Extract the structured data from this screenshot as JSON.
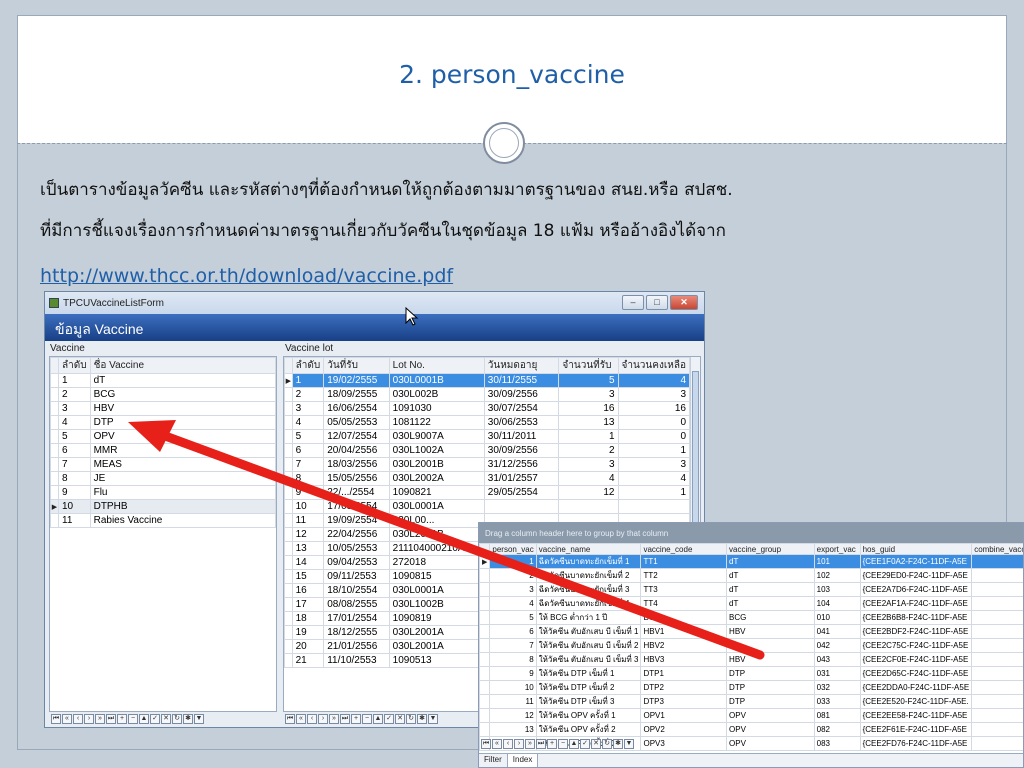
{
  "slide": {
    "title": "2. person_vaccine",
    "body_line1": "เป็นตารางข้อมูลวัคซีน และรหัสต่างๆที่ต้องกำหนดให้ถูกต้องตามมาตรฐานของ สนย.หรือ สปสช.",
    "body_line2": "ที่มีการชี้แจงเรื่องการกำหนดค่ามาตรฐานเกี่ยวกับวัคซีนในชุดข้อมูล 18 แฟ้ม หรืออ้างอิงได้จาก",
    "link": "http://www.thcc.or.th/download/vaccine.pdf"
  },
  "form": {
    "window_title": "TPCUVaccineListForm",
    "header": "ข้อมูล Vaccine",
    "left_panel_label": "Vaccine",
    "right_panel_label": "Vaccine lot",
    "left_columns": [
      "ลำดับ",
      "ชื่อ Vaccine"
    ],
    "vaccines": [
      {
        "no": "1",
        "name": "dT"
      },
      {
        "no": "2",
        "name": "BCG"
      },
      {
        "no": "3",
        "name": "HBV"
      },
      {
        "no": "4",
        "name": "DTP"
      },
      {
        "no": "5",
        "name": "OPV"
      },
      {
        "no": "6",
        "name": "MMR"
      },
      {
        "no": "7",
        "name": "MEAS"
      },
      {
        "no": "8",
        "name": "JE"
      },
      {
        "no": "9",
        "name": "Flu"
      },
      {
        "no": "10",
        "name": "DTPHB"
      },
      {
        "no": "11",
        "name": "Rabies Vaccine"
      }
    ],
    "selected_vaccine_index": 9,
    "lot_columns": [
      "ลำดับ",
      "วันที่รับ",
      "Lot No.",
      "วันหมดอายุ",
      "จำนวนที่รับ",
      "จำนวนคงเหลือ"
    ],
    "lots": [
      {
        "no": "1",
        "received": "19/02/2555",
        "lot": "030L0001B",
        "expiry": "30/11/2555",
        "qty": "5",
        "remain": "4"
      },
      {
        "no": "2",
        "received": "18/09/2555",
        "lot": "030L002B",
        "expiry": "30/09/2556",
        "qty": "3",
        "remain": "3"
      },
      {
        "no": "3",
        "received": "16/06/2554",
        "lot": "1091030",
        "expiry": "30/07/2554",
        "qty": "16",
        "remain": "16"
      },
      {
        "no": "4",
        "received": "05/05/2553",
        "lot": "1081122",
        "expiry": "30/06/2553",
        "qty": "13",
        "remain": "0"
      },
      {
        "no": "5",
        "received": "12/07/2554",
        "lot": "030L9007A",
        "expiry": "30/11/2011",
        "qty": "1",
        "remain": "0"
      },
      {
        "no": "6",
        "received": "20/04/2556",
        "lot": "030L1002A",
        "expiry": "30/09/2556",
        "qty": "2",
        "remain": "1"
      },
      {
        "no": "7",
        "received": "18/03/2556",
        "lot": "030L2001B",
        "expiry": "31/12/2556",
        "qty": "3",
        "remain": "3"
      },
      {
        "no": "8",
        "received": "15/05/2556",
        "lot": "030L2002A",
        "expiry": "31/01/2557",
        "qty": "4",
        "remain": "4"
      },
      {
        "no": "9",
        "received": "22/.../2554",
        "lot": "1090821",
        "expiry": "29/05/2554",
        "qty": "12",
        "remain": "1"
      },
      {
        "no": "10",
        "received": "17/08/2554",
        "lot": "030L0001A",
        "expiry": "",
        "qty": "",
        "remain": ""
      },
      {
        "no": "11",
        "received": "19/09/2554",
        "lot": "030L00...",
        "expiry": "",
        "qty": "",
        "remain": ""
      },
      {
        "no": "12",
        "received": "22/04/2556",
        "lot": "030L2001B",
        "expiry": "",
        "qty": "",
        "remain": ""
      },
      {
        "no": "13",
        "received": "10/05/2553",
        "lot": "211104000210A",
        "expiry": "",
        "qty": "",
        "remain": ""
      },
      {
        "no": "14",
        "received": "09/04/2553",
        "lot": "272018",
        "expiry": "",
        "qty": "",
        "remain": ""
      },
      {
        "no": "15",
        "received": "09/11/2553",
        "lot": "1090815",
        "expiry": "",
        "qty": "",
        "remain": ""
      },
      {
        "no": "16",
        "received": "18/10/2554",
        "lot": "030L0001A",
        "expiry": "",
        "qty": "",
        "remain": ""
      },
      {
        "no": "17",
        "received": "08/08/2555",
        "lot": "030L1002B",
        "expiry": "",
        "qty": "",
        "remain": ""
      },
      {
        "no": "18",
        "received": "17/01/2554",
        "lot": "1090819",
        "expiry": "",
        "qty": "",
        "remain": ""
      },
      {
        "no": "19",
        "received": "18/12/2555",
        "lot": "030L2001A",
        "expiry": "",
        "qty": "",
        "remain": ""
      },
      {
        "no": "20",
        "received": "21/01/2556",
        "lot": "030L2001A",
        "expiry": "",
        "qty": "",
        "remain": ""
      },
      {
        "no": "21",
        "received": "11/10/2553",
        "lot": "1090513",
        "expiry": "",
        "qty": "",
        "remain": ""
      }
    ],
    "selected_lot_index": 0
  },
  "grid2": {
    "group_hint": "Drag a column header here to group by that column",
    "columns": [
      "person_vac",
      "vaccine_name",
      "vaccine_code",
      "vaccine_group",
      "export_vac",
      "hos_guid",
      "combine_vaccine"
    ],
    "rows": [
      {
        "id": "1",
        "name": "ฉีดวัคซีนบาดทะยักเข็มที่ 1",
        "code": "TT1",
        "group": "dT",
        "export": "101",
        "guid": "{CEE1F0A2-F24C-11DF-A5E"
      },
      {
        "id": "2",
        "name": "ฉีดวัคซีนบาดทะยักเข็มที่ 2",
        "code": "TT2",
        "group": "dT",
        "export": "102",
        "guid": "{CEE29ED0-F24C-11DF-A5E"
      },
      {
        "id": "3",
        "name": "ฉีดวัคซีนบาดทะยักเข็มที่ 3",
        "code": "TT3",
        "group": "dT",
        "export": "103",
        "guid": "{CEE2A7D6-F24C-11DF-A5E"
      },
      {
        "id": "4",
        "name": "ฉีดวัคซีนบาดทะยักเข็มที่ 4",
        "code": "TT4",
        "group": "dT",
        "export": "104",
        "guid": "{CEE2AF1A-F24C-11DF-A5E"
      },
      {
        "id": "5",
        "name": "ให้ BCG ต่ำกว่า 1 ปี",
        "code": "BCG",
        "group": "BCG",
        "export": "010",
        "guid": "{CEE2B6B8-F24C-11DF-A5E"
      },
      {
        "id": "6",
        "name": "ให้วัคซีน ตับอักเสบ บี เข็มที่ 1",
        "code": "HBV1",
        "group": "HBV",
        "export": "041",
        "guid": "{CEE2BDF2-F24C-11DF-A5E"
      },
      {
        "id": "7",
        "name": "ให้วัคซีน ตับอักเสบ บี เข็มที่ 2",
        "code": "HBV2",
        "group": "",
        "export": "042",
        "guid": "{CEE2C75C-F24C-11DF-A5E"
      },
      {
        "id": "8",
        "name": "ให้วัคซีน ตับอักเสบ บี เข็มที่ 3",
        "code": "HBV3",
        "group": "HBV",
        "export": "043",
        "guid": "{CEE2CF0E-F24C-11DF-A5E"
      },
      {
        "id": "9",
        "name": "ให้วัคซีน DTP เข็มที่ 1",
        "code": "DTP1",
        "group": "DTP",
        "export": "031",
        "guid": "{CEE2D65C-F24C-11DF-A5E"
      },
      {
        "id": "10",
        "name": "ให้วัคซีน DTP เข็มที่ 2",
        "code": "DTP2",
        "group": "DTP",
        "export": "032",
        "guid": "{CEE2DDA0-F24C-11DF-A5E"
      },
      {
        "id": "11",
        "name": "ให้วัคซีน DTP เข็มที่ 3",
        "code": "DTP3",
        "group": "DTP",
        "export": "033",
        "guid": "{CEE2E520-F24C-11DF-A5E."
      },
      {
        "id": "12",
        "name": "ให้วัคซีน OPV ครั้งที่ 1",
        "code": "OPV1",
        "group": "OPV",
        "export": "081",
        "guid": "{CEE2EE58-F24C-11DF-A5E"
      },
      {
        "id": "13",
        "name": "ให้วัคซีน OPV ครั้งที่ 2",
        "code": "OPV2",
        "group": "OPV",
        "export": "082",
        "guid": "{CEE2F61E-F24C-11DF-A5E"
      },
      {
        "id": "14",
        "name": "ให้วัคซีน OPV ครั้งที่ 3",
        "code": "OPV3",
        "group": "OPV",
        "export": "083",
        "guid": "{CEE2FD76-F24C-11DF-A5E"
      }
    ],
    "selected_row_index": 0,
    "tabs": [
      "Filter",
      "Index"
    ]
  },
  "colors": {
    "title": "#1f5fa8",
    "header_bar": "#1f4a96",
    "selection": "#3a8de0",
    "arrow": "#e8201a"
  },
  "icons": {
    "window_icon": "app-icon",
    "cursor": "mouse-pointer-icon",
    "nav": [
      "first-icon",
      "prev-page-icon",
      "prev-icon",
      "next-icon",
      "next-page-icon",
      "last-icon",
      "add-icon",
      "delete-icon",
      "edit-icon",
      "post-icon",
      "cancel-icon",
      "refresh-icon",
      "bookmark-icon",
      "filter-icon"
    ]
  }
}
